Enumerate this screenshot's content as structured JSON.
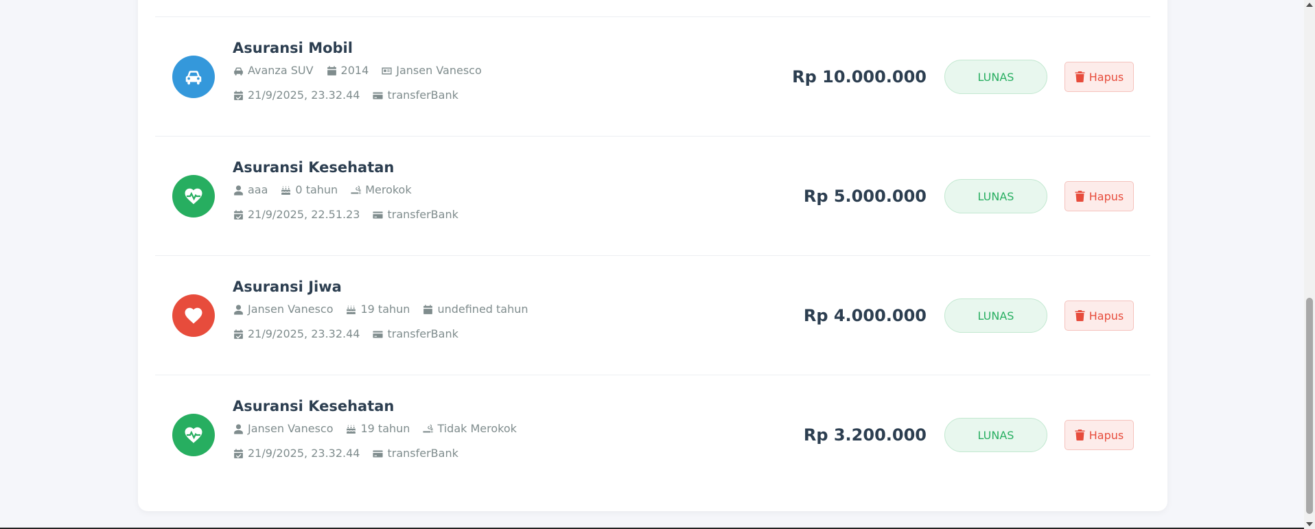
{
  "colors": {
    "car": "#3498db",
    "health": "#27ae60",
    "life": "#e74c3c",
    "status_green": "#27ae60",
    "danger": "#e74c3c"
  },
  "items": [
    {
      "title": "Asuransi Mobil",
      "icon": "car-icon",
      "meta": [
        {
          "icon": "car-icon",
          "text": "Avanza SUV"
        },
        {
          "icon": "calendar-icon",
          "text": "2014"
        },
        {
          "icon": "id-card-icon",
          "text": "Jansen Vanesco"
        }
      ],
      "date": "21/9/2025, 23.32.44",
      "payment": "transferBank",
      "amount": "Rp 10.000.000",
      "status": "LUNAS",
      "delete_label": "Hapus"
    },
    {
      "title": "Asuransi Kesehatan",
      "icon": "heartbeat-icon",
      "meta": [
        {
          "icon": "user-icon",
          "text": "aaa"
        },
        {
          "icon": "birthday-cake-icon",
          "text": "0 tahun"
        },
        {
          "icon": "smoking-icon",
          "text": "Merokok"
        }
      ],
      "date": "21/9/2025, 22.51.23",
      "payment": "transferBank",
      "amount": "Rp 5.000.000",
      "status": "LUNAS",
      "delete_label": "Hapus"
    },
    {
      "title": "Asuransi Jiwa",
      "icon": "heart-icon",
      "meta": [
        {
          "icon": "user-icon",
          "text": "Jansen Vanesco"
        },
        {
          "icon": "birthday-cake-icon",
          "text": "19 tahun"
        },
        {
          "icon": "calendar-icon",
          "text": "undefined tahun"
        }
      ],
      "date": "21/9/2025, 23.32.44",
      "payment": "transferBank",
      "amount": "Rp 4.000.000",
      "status": "LUNAS",
      "delete_label": "Hapus"
    },
    {
      "title": "Asuransi Kesehatan",
      "icon": "heartbeat-icon",
      "meta": [
        {
          "icon": "user-icon",
          "text": "Jansen Vanesco"
        },
        {
          "icon": "birthday-cake-icon",
          "text": "19 tahun"
        },
        {
          "icon": "smoking-icon",
          "text": "Tidak Merokok"
        }
      ],
      "date": "21/9/2025, 23.32.44",
      "payment": "transferBank",
      "amount": "Rp 3.200.000",
      "status": "LUNAS",
      "delete_label": "Hapus"
    }
  ]
}
